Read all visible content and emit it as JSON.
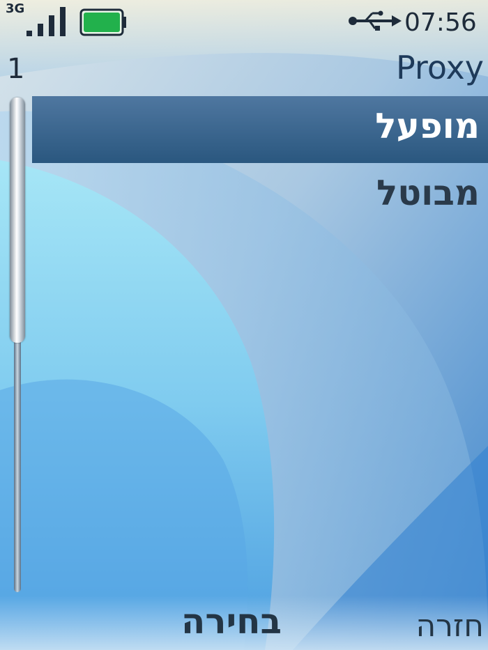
{
  "status_bar": {
    "network": "3G",
    "time": "07:56",
    "signal_icon": "signal-strength-icon",
    "battery_icon": "battery-icon",
    "usb_icon": "usb-icon"
  },
  "header": {
    "index": "1",
    "title": "Proxy"
  },
  "menu": {
    "items": [
      {
        "label": "מופעל",
        "selected": true
      },
      {
        "label": "מבוטל",
        "selected": false
      }
    ]
  },
  "softkeys": {
    "center": "בחירה",
    "right": "חזרה"
  },
  "colors": {
    "selection": "#2a577f",
    "text": "#1e2b3a",
    "battery": "#22b14c"
  }
}
